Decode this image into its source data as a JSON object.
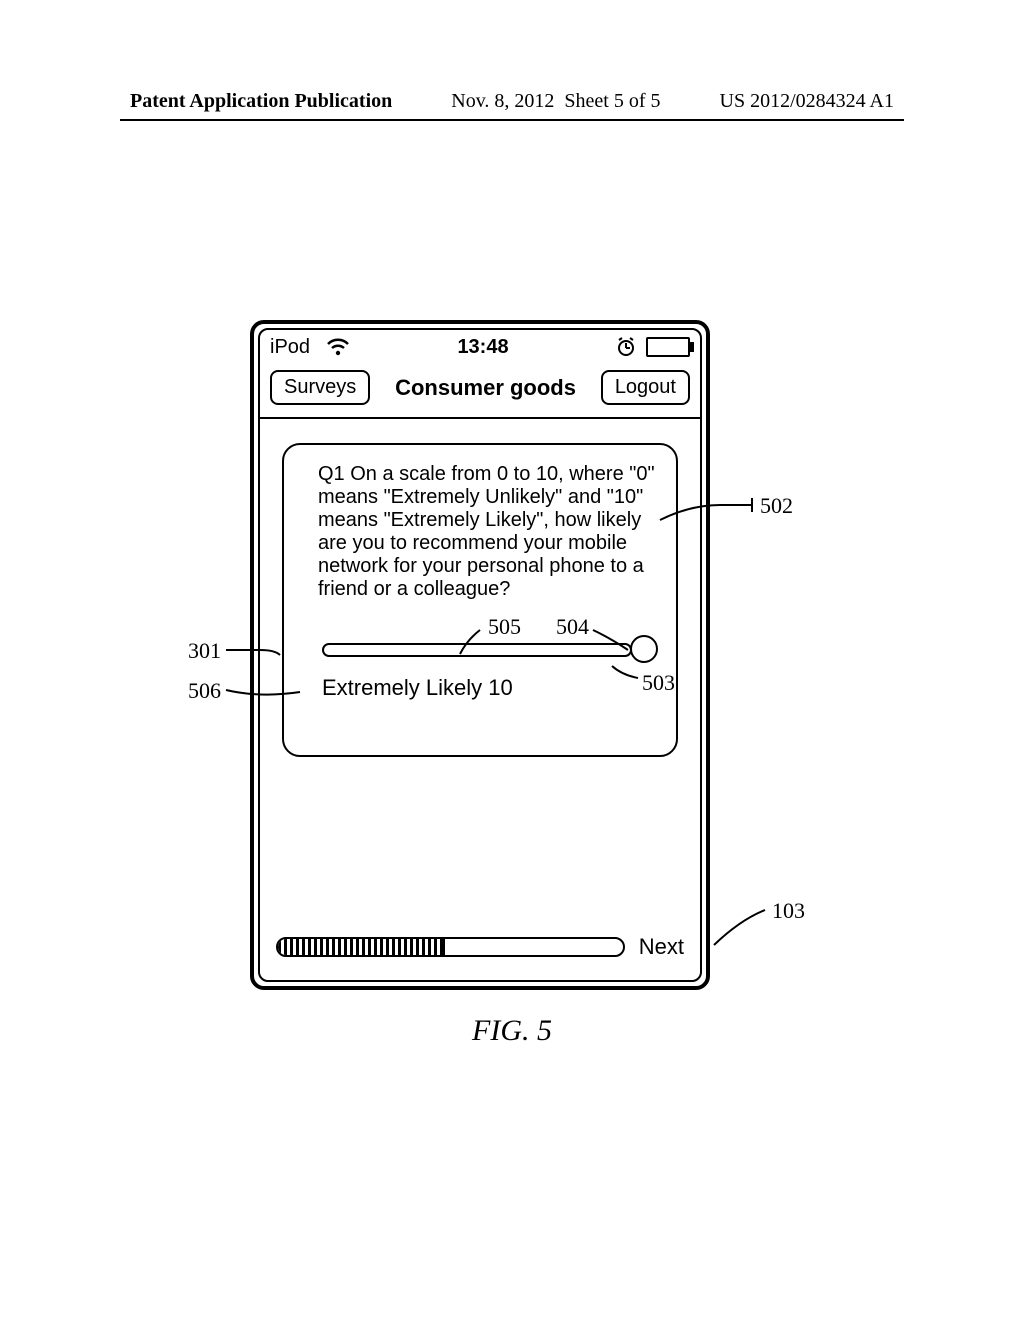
{
  "header": {
    "publication_label": "Patent Application Publication",
    "date": "Nov. 8, 2012",
    "sheet": "Sheet 5 of 5",
    "docket": "US 2012/0284324 A1"
  },
  "statusbar": {
    "carrier": "iPod",
    "time": "13:48"
  },
  "navbar": {
    "back": "Surveys",
    "title": "Consumer goods",
    "logout": "Logout"
  },
  "question": {
    "text": "Q1  On a scale from 0 to 10, where \"0\" means \"Extremely Unlikely\" and \"10\" means \"Extremely Likely\", how likely are you to recommend your mobile network for your personal phone to a friend or a colleague?",
    "value_label": "Extremely Likely 10"
  },
  "footer": {
    "next": "Next"
  },
  "callouts": {
    "c301": "301",
    "c502": "502",
    "c503": "503",
    "c504": "504",
    "c505": "505",
    "c506": "506",
    "c103": "103"
  },
  "caption": "FIG. 5"
}
